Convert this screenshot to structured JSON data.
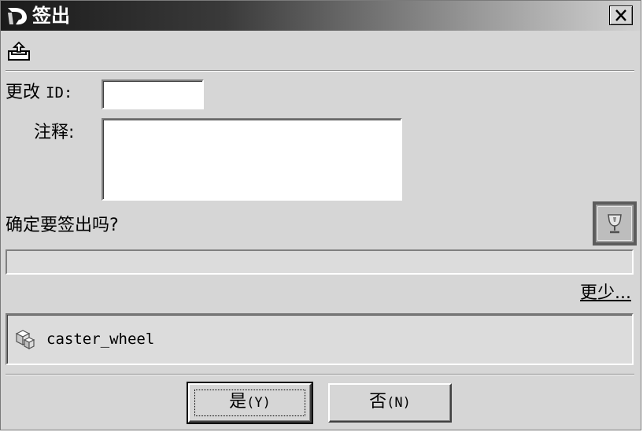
{
  "window": {
    "title": "签出"
  },
  "form": {
    "change_id_label_cn": "更改",
    "change_id_label_id": "ID:",
    "change_id_value": "",
    "comment_label": "注释:",
    "comment_value": ""
  },
  "confirm_text": "确定要签出吗?",
  "progress": 0,
  "less_link": "更少...",
  "items": [
    {
      "name": "caster_wheel",
      "icon": "part-icon"
    }
  ],
  "buttons": {
    "yes_label": "是",
    "yes_hotkey": "(Y)",
    "no_label": "否",
    "no_hotkey": "(N)"
  }
}
